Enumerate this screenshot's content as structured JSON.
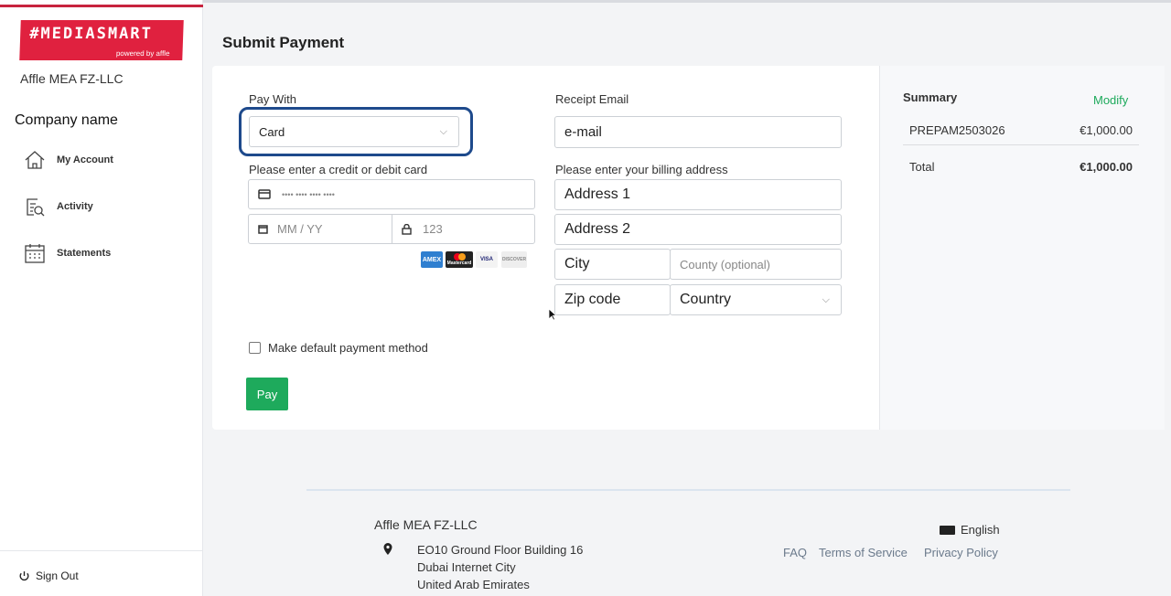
{
  "brand": {
    "logo_text": "#MEDIASMART",
    "logo_sub": "powered by affle",
    "org": "Affle MEA FZ-LLC",
    "company_label": "Company name"
  },
  "nav": [
    {
      "label": "My Account"
    },
    {
      "label": "Activity"
    },
    {
      "label": "Statements"
    }
  ],
  "signout": "Sign Out",
  "page_title": "Submit Payment",
  "form": {
    "pay_with_label": "Pay With",
    "pay_with_value": "Card",
    "card_label": "Please enter a credit or debit card",
    "card_number_placeholder": "•••• •••• •••• ••••",
    "expiry_placeholder": "MM / YY",
    "cvc_placeholder": "123",
    "card_brands": [
      "AMEX",
      "Mastercard",
      "VISA",
      "DISCOVER"
    ],
    "receipt_label": "Receipt Email",
    "receipt_value": "e-mail",
    "billing_label": "Please enter your billing address",
    "address1": "Address 1",
    "address2": "Address 2",
    "city": "City",
    "county_placeholder": "County (optional)",
    "zip": "Zip code",
    "country": "Country",
    "default_label": "Make default payment method",
    "pay_button": "Pay"
  },
  "summary": {
    "title": "Summary",
    "modify": "Modify",
    "item": "PREPAM2503026",
    "item_amount": "€1,000.00",
    "total_label": "Total",
    "total_amount": "€1,000.00"
  },
  "footer": {
    "company": "Affle MEA FZ-LLC",
    "address": [
      "EO10 Ground Floor Building 16",
      "Dubai Internet City",
      "United Arab Emirates"
    ],
    "language": "English",
    "links": [
      "FAQ",
      "Terms of Service",
      "Privacy Policy"
    ]
  },
  "colors": {
    "brand_red": "#e0213f",
    "pay_green": "#1eaa5c",
    "focus_blue": "#1e4a8c",
    "modify_green": "#1eaa5c"
  }
}
